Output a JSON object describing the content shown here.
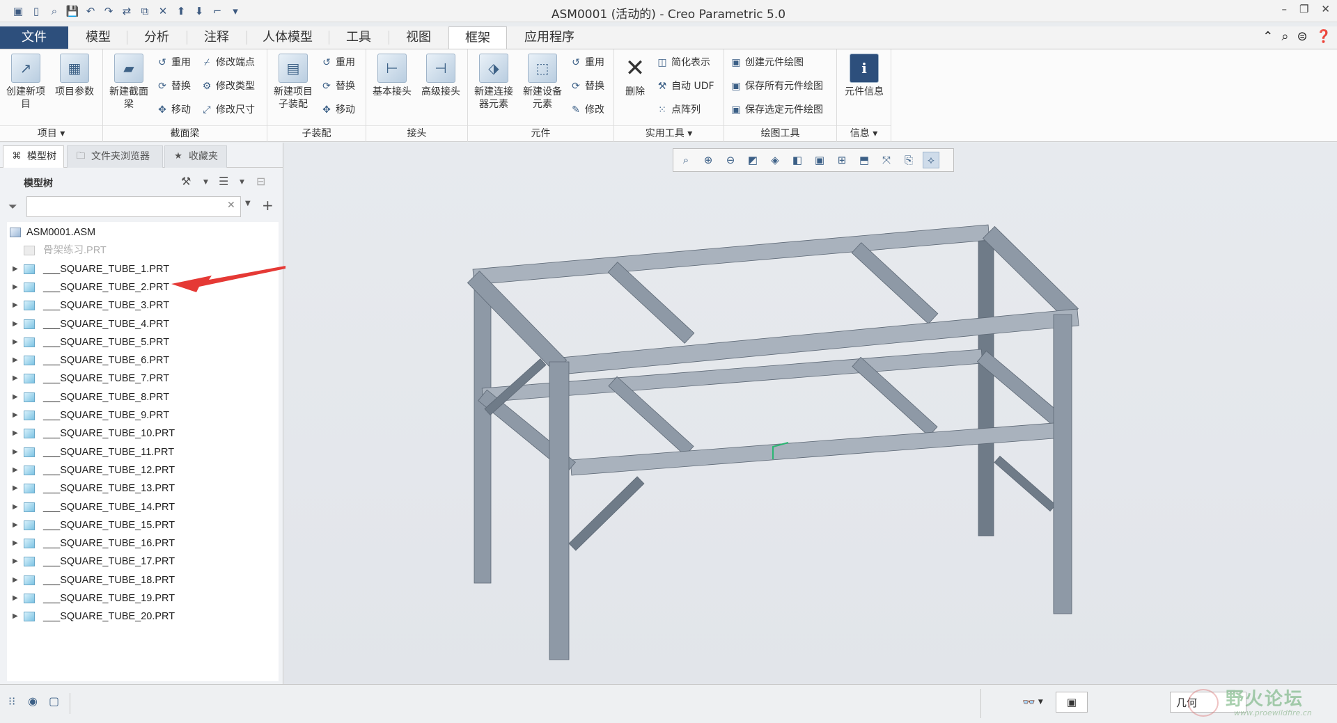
{
  "window": {
    "title": "ASM0001 (活动的) - Creo Parametric 5.0",
    "controls": [
      "–",
      "❐",
      "✕"
    ]
  },
  "quick_access": [
    "▣",
    "▯",
    "⌕",
    "💾",
    "↶",
    "↷",
    "⇄",
    "⧉",
    "✕",
    "⬆",
    "⬇",
    "⌐",
    "▾"
  ],
  "tabs": [
    {
      "label": "文件"
    },
    {
      "label": "模型"
    },
    {
      "label": "分析"
    },
    {
      "label": "注释"
    },
    {
      "label": "人体模型"
    },
    {
      "label": "工具"
    },
    {
      "label": "视图"
    },
    {
      "label": "框架"
    },
    {
      "label": "应用程序"
    }
  ],
  "ribbon": {
    "groups": [
      {
        "label": "项目 ▾"
      },
      {
        "label": "截面梁"
      },
      {
        "label": "子装配"
      },
      {
        "label": "接头"
      },
      {
        "label": "元件"
      },
      {
        "label": "实用工具 ▾"
      },
      {
        "label": "绘图工具"
      },
      {
        "label": "信息 ▾"
      }
    ],
    "big_buttons": [
      {
        "line1": "创建新项",
        "line2": "目",
        "icon": "↗"
      },
      {
        "line1": "项目参数",
        "line2": "",
        "icon": "▦"
      },
      {
        "line1": "新建截面",
        "line2": "梁",
        "icon": "▰"
      },
      {
        "line1": "新建项目",
        "line2": "子装配",
        "icon": "▤"
      },
      {
        "line1": "基本接头",
        "line2": "",
        "icon": "⊢"
      },
      {
        "line1": "高级接头",
        "line2": "",
        "icon": "⊣"
      },
      {
        "line1": "新建连接",
        "line2": "器元素",
        "icon": "⬗"
      },
      {
        "line1": "新建设备",
        "line2": "元素",
        "icon": "⬚"
      },
      {
        "line1": "删除",
        "line2": "",
        "icon": "✕"
      },
      {
        "line1": "元件信息",
        "line2": "",
        "icon": "i"
      }
    ],
    "small_buttons": [
      {
        "label": "重用",
        "icon": "↺"
      },
      {
        "label": "替换",
        "icon": "⟳"
      },
      {
        "label": "移动",
        "icon": "✥"
      },
      {
        "label": "修改端点",
        "icon": "⌿"
      },
      {
        "label": "修改类型",
        "icon": "⚙"
      },
      {
        "label": "修改尺寸",
        "icon": "⤢"
      },
      {
        "label": "重用",
        "icon": "↺"
      },
      {
        "label": "替换",
        "icon": "⟳"
      },
      {
        "label": "移动",
        "icon": "✥"
      },
      {
        "label": "重用",
        "icon": "↺"
      },
      {
        "label": "替换",
        "icon": "⟳"
      },
      {
        "label": "修改",
        "icon": "✎"
      },
      {
        "label": "简化表示",
        "icon": "◫"
      },
      {
        "label": "自动 UDF",
        "icon": "⚒"
      },
      {
        "label": "点阵列",
        "icon": "⁙"
      },
      {
        "label": "创建元件绘图",
        "icon": "▣"
      },
      {
        "label": "保存所有元件绘图",
        "icon": "▣"
      },
      {
        "label": "保存选定元件绘图",
        "icon": "▣"
      }
    ]
  },
  "left_panel": {
    "tabs": [
      {
        "label": "模型树",
        "icon": "⌘"
      },
      {
        "label": "文件夹浏览器",
        "icon": "🗀"
      },
      {
        "label": "收藏夹",
        "icon": "★"
      }
    ],
    "tree_label": "模型树",
    "filter_placeholder": "",
    "tree_items": [
      {
        "name": "ASM0001.ASM",
        "kind": "asm",
        "expandable": false
      },
      {
        "name": "骨架练习.PRT",
        "kind": "skeleton",
        "expandable": false
      },
      {
        "name": "___SQUARE_TUBE_1.PRT",
        "kind": "part",
        "expandable": true
      },
      {
        "name": "___SQUARE_TUBE_2.PRT",
        "kind": "part",
        "expandable": true
      },
      {
        "name": "___SQUARE_TUBE_3.PRT",
        "kind": "part",
        "expandable": true
      },
      {
        "name": "___SQUARE_TUBE_4.PRT",
        "kind": "part",
        "expandable": true
      },
      {
        "name": "___SQUARE_TUBE_5.PRT",
        "kind": "part",
        "expandable": true
      },
      {
        "name": "___SQUARE_TUBE_6.PRT",
        "kind": "part",
        "expandable": true
      },
      {
        "name": "___SQUARE_TUBE_7.PRT",
        "kind": "part",
        "expandable": true
      },
      {
        "name": "___SQUARE_TUBE_8.PRT",
        "kind": "part",
        "expandable": true
      },
      {
        "name": "___SQUARE_TUBE_9.PRT",
        "kind": "part",
        "expandable": true
      },
      {
        "name": "___SQUARE_TUBE_10.PRT",
        "kind": "part",
        "expandable": true
      },
      {
        "name": "___SQUARE_TUBE_11.PRT",
        "kind": "part",
        "expandable": true
      },
      {
        "name": "___SQUARE_TUBE_12.PRT",
        "kind": "part",
        "expandable": true
      },
      {
        "name": "___SQUARE_TUBE_13.PRT",
        "kind": "part",
        "expandable": true
      },
      {
        "name": "___SQUARE_TUBE_14.PRT",
        "kind": "part",
        "expandable": true
      },
      {
        "name": "___SQUARE_TUBE_15.PRT",
        "kind": "part",
        "expandable": true
      },
      {
        "name": "___SQUARE_TUBE_16.PRT",
        "kind": "part",
        "expandable": true
      },
      {
        "name": "___SQUARE_TUBE_17.PRT",
        "kind": "part",
        "expandable": true
      },
      {
        "name": "___SQUARE_TUBE_18.PRT",
        "kind": "part",
        "expandable": true
      },
      {
        "name": "___SQUARE_TUBE_19.PRT",
        "kind": "part",
        "expandable": true
      },
      {
        "name": "___SQUARE_TUBE_20.PRT",
        "kind": "part",
        "expandable": true
      }
    ]
  },
  "view_toolbar": [
    "⌕",
    "⊕",
    "⊖",
    "◩",
    "◈",
    "◧",
    "▣",
    "⊞",
    "⬒",
    "⤧",
    "⎘",
    "⟡"
  ],
  "status_bar": {
    "filter_value": "几何",
    "watermark_title": "野火论坛",
    "watermark_url": "www.proewildfire.cn"
  },
  "colors": {
    "file_tab": "#2d4f7c",
    "frame_face": "#8e99a6",
    "frame_top": "#a9b2bd",
    "frame_side": "#6f7b88",
    "annotation_arrow": "#e53935"
  }
}
